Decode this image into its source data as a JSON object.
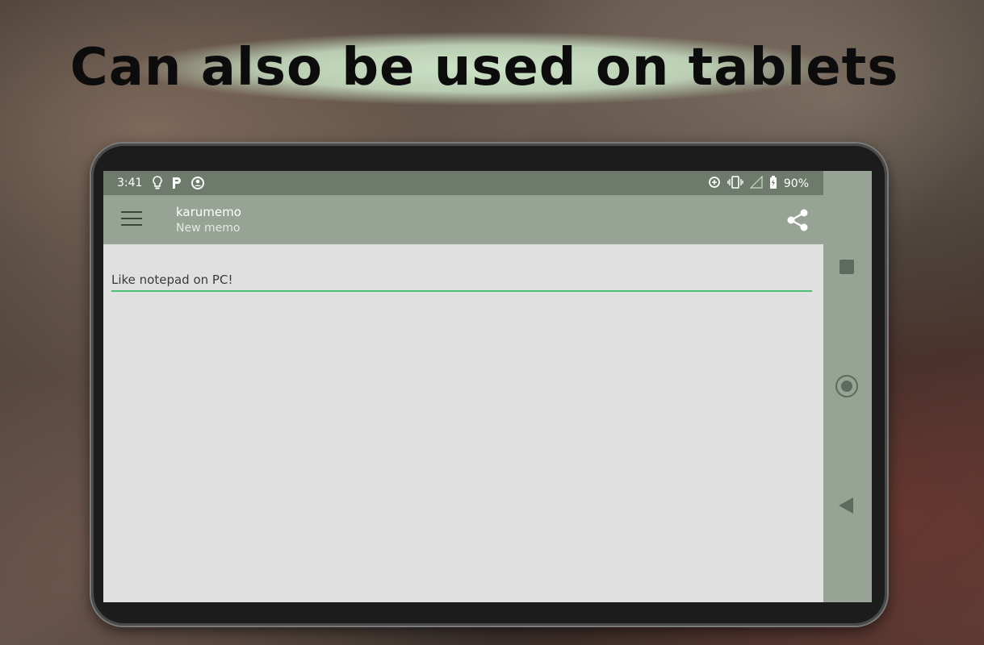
{
  "headline": "Can also be used on tablets",
  "status_bar": {
    "time": "3:41",
    "battery": "90%",
    "left_icons": [
      "lightbulb-icon",
      "p-notification-icon",
      "sync-person-icon"
    ],
    "right_icons": [
      "data-saver-icon",
      "vibrate-icon",
      "signal-icon",
      "battery-icon"
    ]
  },
  "app_bar": {
    "title": "karumemo",
    "subtitle": "New memo"
  },
  "memo": {
    "text": "Like notepad on PC!"
  },
  "colors": {
    "status_bar": "#6e7b6c",
    "app_bar": "#97a394",
    "content_bg": "#e0e0e0",
    "underline_accent": "#4cc072"
  }
}
